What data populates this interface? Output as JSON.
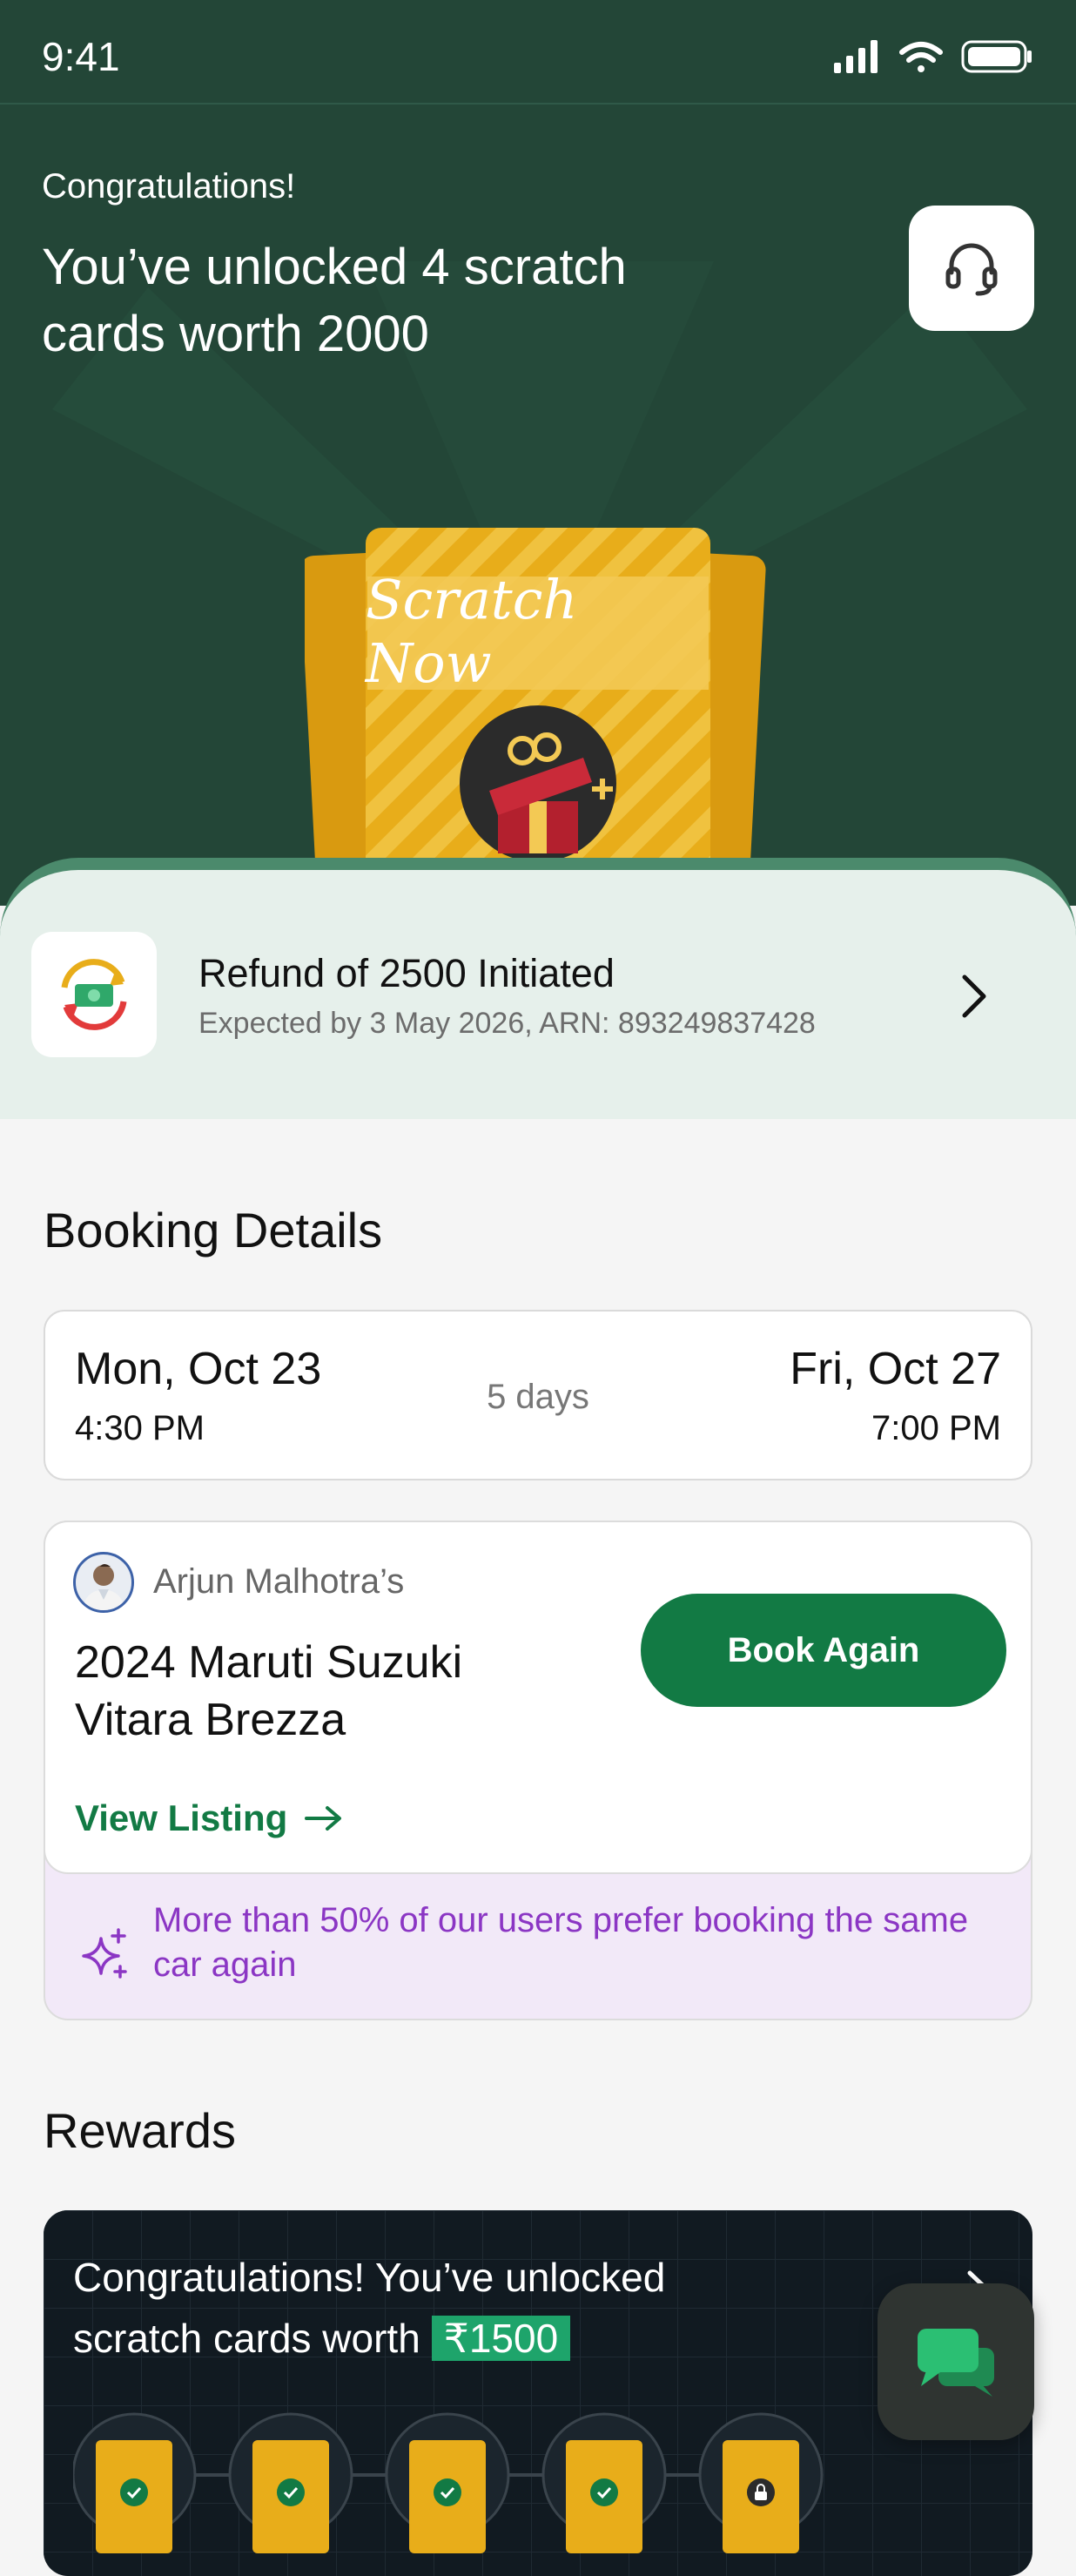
{
  "status_bar": {
    "time": "9:41"
  },
  "hero": {
    "congrats": "Congratulations!",
    "title": "You’ve unlocked 4 scratch cards worth 2000",
    "scratch_label": "Scratch Now"
  },
  "refund": {
    "title": "Refund of 2500 Initiated",
    "subtitle": "Expected by 3 May 2026, ARN: 893249837428"
  },
  "booking": {
    "section_title": "Booking Details",
    "start_date": "Mon, Oct 23",
    "start_time": "4:30 PM",
    "duration": "5 days",
    "end_date": "Fri, Oct 27",
    "end_time": "7:00 PM",
    "owner": "Arjun Malhotra’s",
    "car_name": "2024 Maruti Suzuki Vitara Brezza",
    "book_again_label": "Book Again",
    "view_listing_label": "View Listing",
    "promo_text": "More than 50% of our users prefer booking the same car again"
  },
  "rewards": {
    "section_title": "Rewards",
    "text": "Congratulations! You’ve unlocked scratch cards worth",
    "amount": "₹1500"
  },
  "colors": {
    "hero_bg": "#234637",
    "accent_green": "#127a44",
    "gold": "#e8ad1a",
    "promo_purple": "#8b36c4"
  }
}
